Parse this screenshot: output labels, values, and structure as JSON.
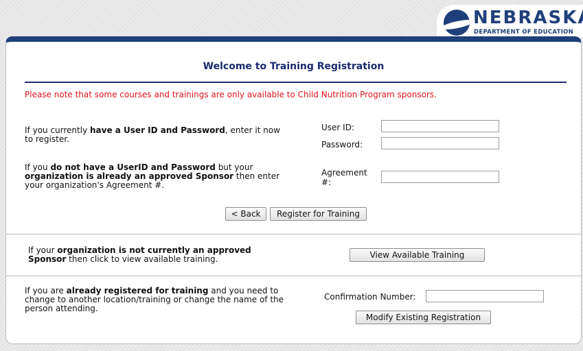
{
  "logo": {
    "title": "NEBRASKA",
    "subtitle": "DEPARTMENT OF EDUCATION"
  },
  "header": {
    "title": "Welcome to Training Registration"
  },
  "notice": "Please note that some courses and trainings are only available to Child Nutrition Program sponsors.",
  "login_section": {
    "desc_1": "If you currently ",
    "desc_2": "have a User ID and Password",
    "desc_3": ", enter it now to register.",
    "userid_label": "User ID:",
    "password_label": "Password:",
    "userid_value": "",
    "password_value": ""
  },
  "agreement_section": {
    "desc_1": "If you ",
    "desc_2": "do not have a UserID and Password",
    "desc_3": " but your ",
    "desc_4": "organization is already an approved Sponsor",
    "desc_5": " then enter your organization's Agreement #.",
    "label_1": "Agreement",
    "label_2": "#:",
    "value": ""
  },
  "buttons": {
    "back": "< Back",
    "register": "Register for Training",
    "view_training": "View Available Training",
    "modify": "Modify Existing Registration"
  },
  "sponsor_section": {
    "desc_1": "If your ",
    "desc_2": "organization is not currently an approved Sponsor",
    "desc_3": " then click to view available training."
  },
  "modify_section": {
    "desc_1": "If you are ",
    "desc_2": "already registered for training",
    "desc_3": " and you need to change to another location/training or change the name of the person attending.",
    "confirmation_label": "Confirmation Number:",
    "confirmation_value": ""
  },
  "colors": {
    "brand_navy": "#1f3f7a",
    "title_navy": "#1a2a6e",
    "notice_red": "#e3121b"
  }
}
